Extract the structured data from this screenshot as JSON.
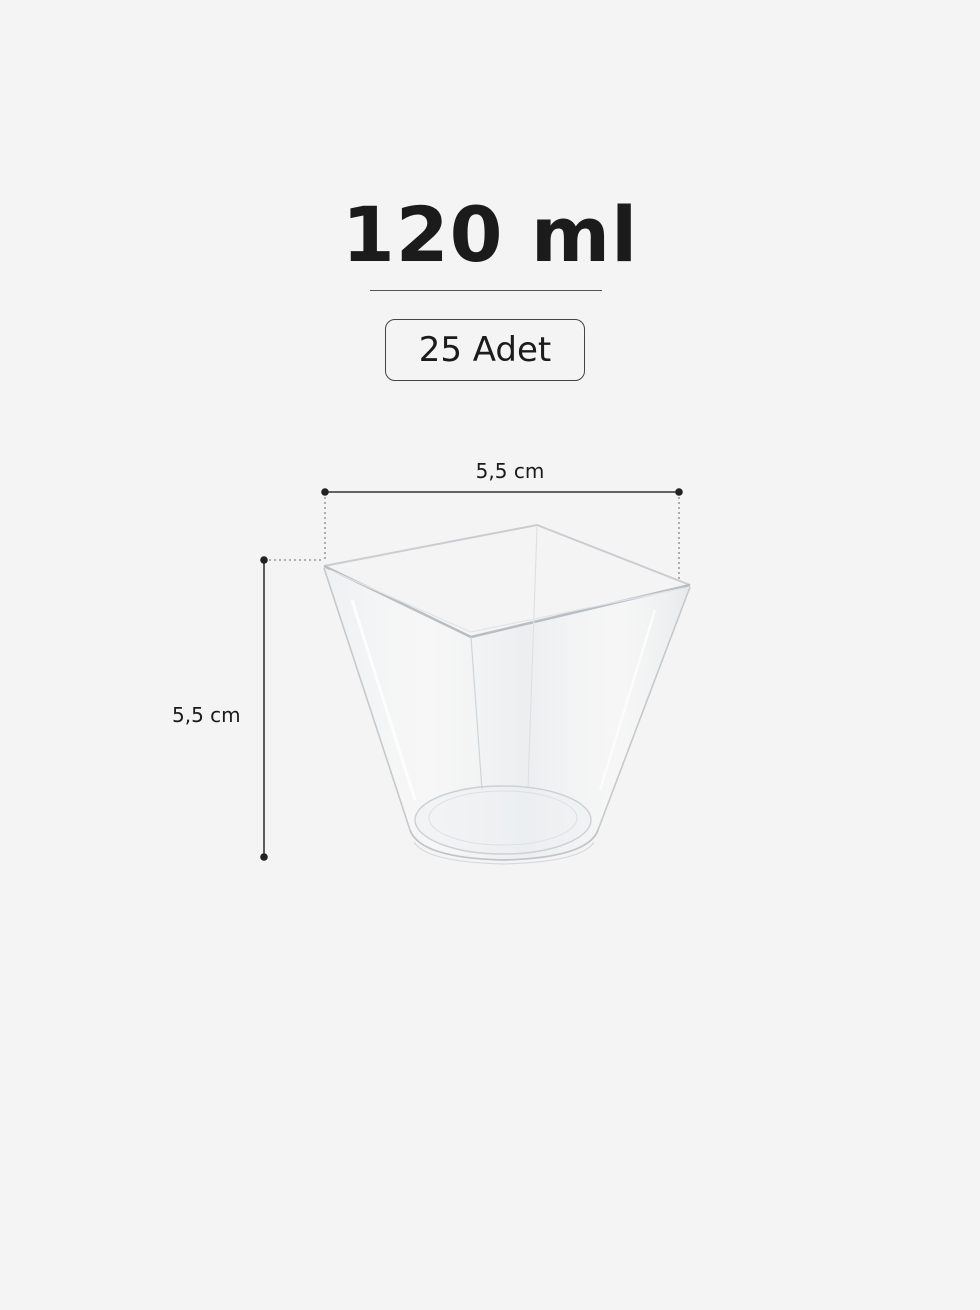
{
  "product": {
    "volume": "120 ml",
    "quantity": "25 Adet"
  },
  "dimensions": {
    "width": "5,5 cm",
    "height": "5,5 cm"
  },
  "colors": {
    "background": "#f4f4f4",
    "text": "#1b1b1b",
    "lines": "#444444"
  }
}
